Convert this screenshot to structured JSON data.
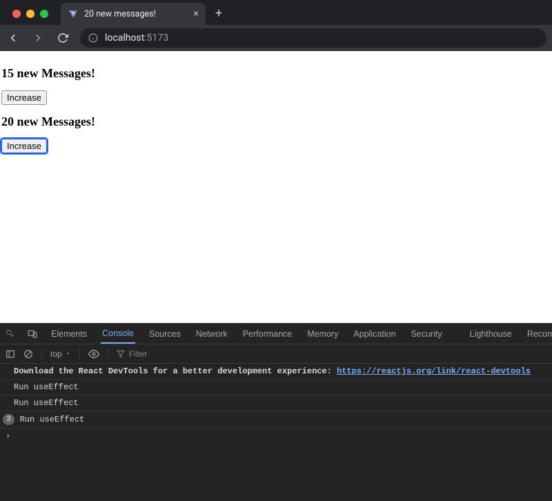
{
  "browser": {
    "tab_title": "20 new messages!",
    "url_host": "localhost",
    "url_port": ":5173"
  },
  "page": {
    "heading1": "15 new Messages!",
    "button1": "Increase",
    "heading2": "20 new Messages!",
    "button2": "Increase"
  },
  "devtools": {
    "tabs": {
      "elements": "Elements",
      "console": "Console",
      "sources": "Sources",
      "network": "Network",
      "performance": "Performance",
      "memory": "Memory",
      "application": "Application",
      "security": "Security",
      "lighthouse": "Lighthouse",
      "recorder": "Record"
    },
    "subbar": {
      "context": "top",
      "filter_placeholder": "Filter"
    },
    "logs": [
      {
        "text": "Download the React DevTools for a better development experience: ",
        "link": "https://reactjs.org/link/react-devtools"
      },
      {
        "text": "Run useEffect"
      },
      {
        "text": "Run useEffect"
      },
      {
        "count": "3",
        "text": "Run useEffect"
      }
    ]
  }
}
